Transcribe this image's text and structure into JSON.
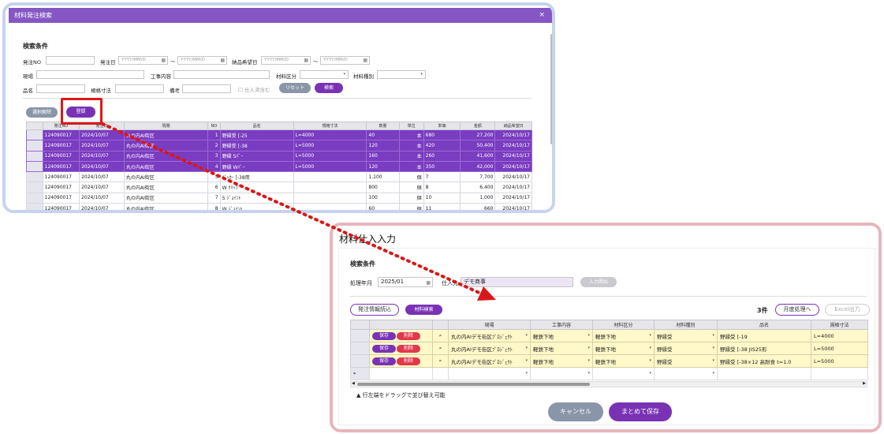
{
  "top_window": {
    "title": "材料発注検索",
    "close": "×",
    "search_title": "検索条件",
    "fields": {
      "order_no": "発注NO",
      "order_date": "発注日",
      "date_placeholder": "YYYY/MM/D",
      "tilde": "〜",
      "delivery_date": "納品希望日",
      "site": "現場",
      "work": "工事内容",
      "material_cat": "材料区分",
      "material_type": "材料種別",
      "item_name": "品名",
      "spec": "規格寸法",
      "note": "備考",
      "include_received": "仕入済含む"
    },
    "buttons": {
      "reset": "リセット",
      "search": "検索",
      "deselect": "選択解除",
      "register": "登録"
    },
    "table": {
      "headers": [
        "",
        "発注NO",
        "発注日",
        "現場",
        "NO",
        "品名",
        "規格寸法",
        "数量",
        "単位",
        "単価",
        "金額",
        "納品希望日"
      ],
      "rows": [
        {
          "sel": true,
          "cells": [
            "124090017",
            "2024/10/07",
            "丸の内AI街区",
            "1",
            "野縁受 [-25",
            "L=4000",
            "40",
            "本",
            "680",
            "27,200",
            "2024/10/17"
          ]
        },
        {
          "sel": true,
          "cells": [
            "124090017",
            "2024/10/07",
            "丸の内AI街区",
            "2",
            "野縁受 [-38",
            "L=5000",
            "120",
            "本",
            "420",
            "50,400",
            "2024/10/17"
          ]
        },
        {
          "sel": true,
          "cells": [
            "124090017",
            "2024/10/07",
            "丸の内AI街区",
            "3",
            "野縁 Sﾊﾞｰ",
            "L=5000",
            "160",
            "本",
            "260",
            "41,600",
            "2024/10/17"
          ]
        },
        {
          "sel": true,
          "cells": [
            "124090017",
            "2024/10/07",
            "丸の内AI街区",
            "4",
            "野縁 Wﾊﾞｰ",
            "L=5000",
            "120",
            "本",
            "350",
            "42,000",
            "2024/10/17"
          ]
        },
        {
          "sel": false,
          "cells": [
            "124090017",
            "2024/10/07",
            "丸の内AI街区",
            "5",
            "ﾊﾟｯｶｰ [-38用",
            "",
            "1,100",
            "個",
            "7",
            "7,700",
            "2024/10/17"
          ]
        },
        {
          "sel": false,
          "cells": [
            "124090017",
            "2024/10/07",
            "丸の内AI街区",
            "6",
            "W ｸﾘｯﾌﾟ",
            "",
            "800",
            "個",
            "8",
            "6,400",
            "2024/10/17"
          ]
        },
        {
          "sel": false,
          "cells": [
            "124090017",
            "2024/10/07",
            "丸の内AI街区",
            "7",
            "S ｼﾞｮｲﾝﾄ",
            "",
            "100",
            "個",
            "10",
            "1,000",
            "2024/10/17"
          ]
        },
        {
          "sel": false,
          "cells": [
            "124090017",
            "2024/10/07",
            "丸の内AI街区",
            "8",
            "W ｼﾞｮｲﾝﾄ",
            "",
            "60",
            "個",
            "11",
            "660",
            "2024/10/17"
          ]
        }
      ]
    }
  },
  "bottom_window": {
    "title": "材料仕入入力",
    "search_title": "検索条件",
    "period_label": "処理年月",
    "period_value": "2025/01",
    "supplier_label": "仕入先",
    "supplier_value": "デモ商事",
    "start_button": "入力開始",
    "order_info_button": "発注情報読込",
    "material_search_button": "材料検索",
    "count": "3件",
    "monthly_button": "月度処理へ",
    "excel_button": "Excel出力",
    "grid": {
      "headers": [
        "",
        "",
        "",
        "現場",
        "工事内容",
        "材料区分",
        "材料種別",
        "品名",
        "規格寸法"
      ],
      "save_label": "保存",
      "delete_label": "削除",
      "rows": [
        [
          "丸の内AIデモ街区ﾌﾟﾛｼﾞｪｸﾄ",
          "軽鉄下地",
          "軽鉄下地",
          "野縁受",
          "野縁受 [-19",
          "L=4000"
        ],
        [
          "丸の内AIデモ街区ﾌﾟﾛｼﾞｪｸﾄ",
          "軽鉄下地",
          "軽鉄下地",
          "野縁受",
          "野縁受 [-38 JIS25形",
          "L=5000"
        ],
        [
          "丸の内AIデモ街区ﾌﾟﾛｼﾞｪｸﾄ",
          "軽鉄下地",
          "軽鉄下地",
          "野縁受",
          "野縁受 [-38×12 高耐食 t=1.0",
          "L=5000"
        ]
      ],
      "new_row_marker": "*"
    },
    "hint": "▲ 行左端をドラッグで並び替え可能",
    "cancel_button": "キャンセル",
    "save_all_button": "まとめて保存"
  },
  "colors": {
    "purple": "#7a32b4",
    "highlight": "#e01818",
    "selected_row": "#7a3cc0"
  },
  "icons": [
    "calendar-icon",
    "search-icon",
    "chevron-down-icon",
    "close-icon"
  ]
}
